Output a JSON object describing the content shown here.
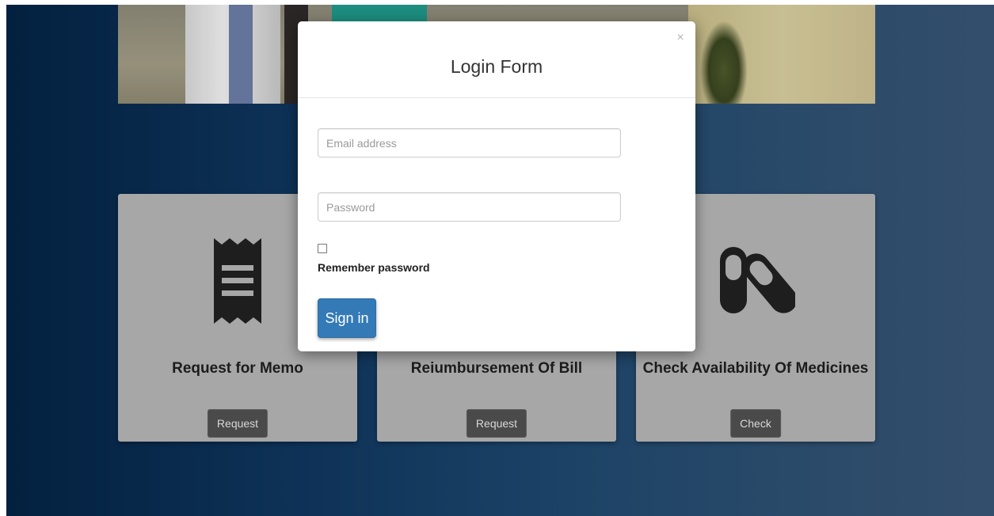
{
  "modal": {
    "title": "Login Form",
    "close_label": "×",
    "email_placeholder": "Email address",
    "password_placeholder": "Password",
    "remember_checked": false,
    "remember_label": "Remember password",
    "signin_label": "Sign in"
  },
  "cards": [
    {
      "icon": "receipt-icon",
      "title": "Request for Memo",
      "button_label": "Request"
    },
    {
      "icon": "bill-icon",
      "title": "Reiumbursement Of Bill",
      "button_label": "Request"
    },
    {
      "icon": "pills-icon",
      "title": "Check Availability Of Medicines",
      "button_label": "Check"
    }
  ],
  "colors": {
    "card_bg": "#a7a7a7",
    "card_button": "#4a4a4a",
    "primary": "#337ab7",
    "page_dark": "#03203f",
    "page_light": "#334e6c"
  }
}
